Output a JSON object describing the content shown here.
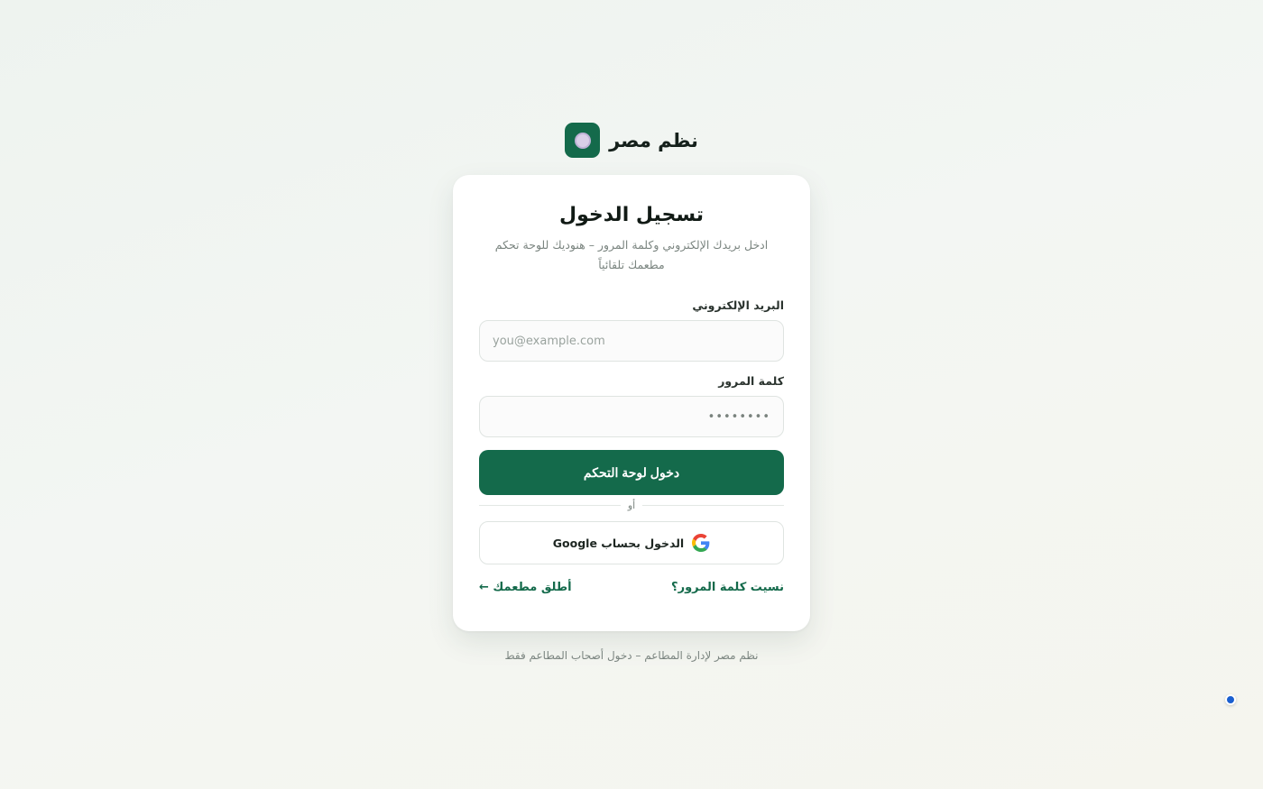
{
  "brand": {
    "name": "نظم مصر",
    "icon": "plate-icon"
  },
  "login": {
    "title": "تسجيل الدخول",
    "subtitle": "ادخل بريدك الإلكتروني وكلمة المرور – هنوديك للوحة تحكم مطعمك تلقائياً",
    "email_label": "البريد الإلكتروني",
    "email_placeholder": "you@example.com",
    "password_label": "كلمة المرور",
    "password_value": "••••••••",
    "submit_label": "دخول لوحة التحكم",
    "or_label": "أو",
    "google_label": "الدخول بحساب Google",
    "forgot_link": "نسيت كلمة المرور؟",
    "launch_link": "أطلق مطعمك ←"
  },
  "footer": {
    "text": "نظم مصر لإدارة المطاعم – دخول أصحاب المطاعم فقط"
  },
  "colors": {
    "primary": "#146a4b",
    "background": "#eef3ef",
    "indicator": "#1a5fd0"
  }
}
